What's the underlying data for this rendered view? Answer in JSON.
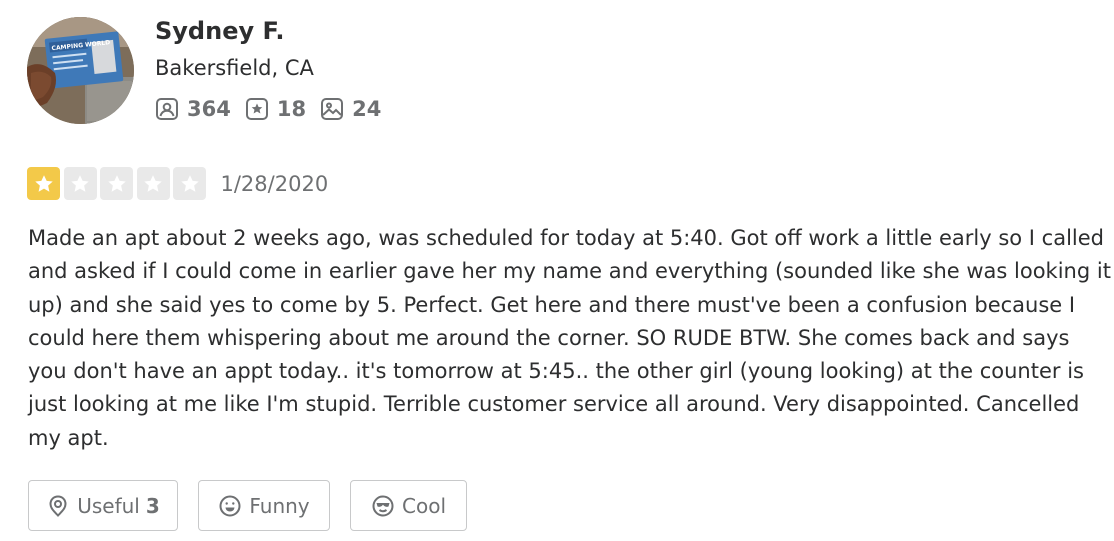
{
  "user": {
    "name": "Sydney F.",
    "location": "Bakersfield, CA",
    "avatar_card_text": "CAMPING WORLD",
    "stats": {
      "friends": "364",
      "reviews": "18",
      "photos": "24"
    }
  },
  "review": {
    "rating": 1,
    "rating_max": 5,
    "date": "1/28/2020",
    "text": "Made an apt about 2 weeks ago, was scheduled for today at 5:40. Got off work a little early so I called and asked if I could come in earlier gave her my name and everything (sounded like she was looking it up) and she said yes to come by 5. Perfect. Get here and there must've been a confusion because I could here them whispering about me around the corner. SO RUDE BTW. She comes back and says you don't have an appt today.. it's tomorrow at 5:45.. the other girl (young looking) at the counter is just looking at me like I'm stupid. Terrible customer service all around. Very disappointed. Cancelled my apt."
  },
  "reactions": {
    "useful_label": "Useful",
    "useful_count": "3",
    "funny_label": "Funny",
    "cool_label": "Cool"
  },
  "icons": {
    "friends": "friends-icon",
    "reviews": "star-review-icon",
    "photos": "photo-icon",
    "useful": "useful-icon",
    "funny": "funny-face-icon",
    "cool": "cool-sunglasses-icon"
  },
  "colors": {
    "star_active": "#f3c949",
    "star_inactive": "#e9e9e9",
    "text_primary": "#2d2e2f",
    "text_secondary": "#6e7072"
  }
}
